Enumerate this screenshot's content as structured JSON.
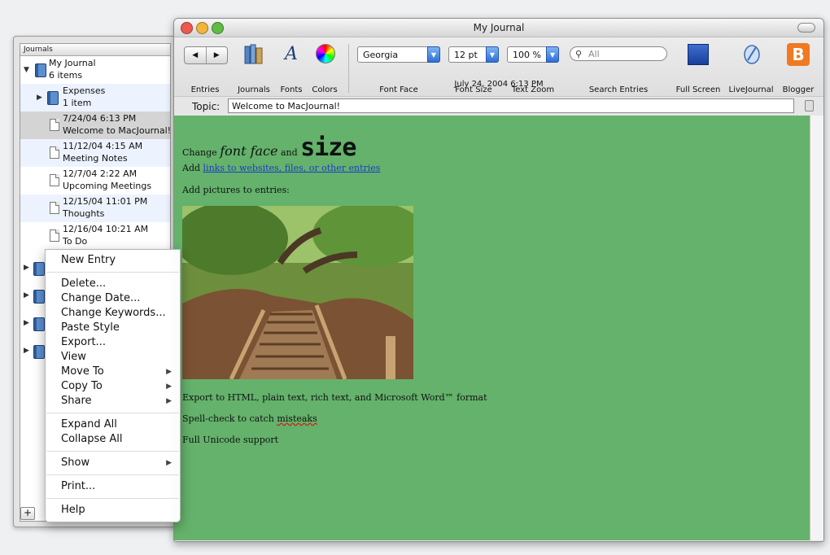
{
  "window": {
    "title": "My Journal",
    "date": "July 24, 2004 6:13 PM"
  },
  "toolbar": {
    "entries": "Entries",
    "journals": "Journals",
    "fonts": "Fonts",
    "colors": "Colors",
    "font_face_label": "Font Face",
    "font_face_value": "Georgia",
    "font_size_label": "Font Size",
    "font_size_value": "12 pt",
    "text_zoom_label": "Text Zoom",
    "text_zoom_value": "100 %",
    "search_label": "Search Entries",
    "search_placeholder": "All",
    "full_screen": "Full Screen",
    "livejournal": "LiveJournal",
    "blogger": "Blogger",
    "nav_prev": "◀",
    "nav_next": "▶"
  },
  "topic": {
    "label": "Topic:",
    "value": "Welcome to MacJournal!"
  },
  "drawer": {
    "header": "Journals",
    "items": [
      {
        "line1": "My Journal",
        "line2": "6 items"
      },
      {
        "line1": "Expenses",
        "line2": "1 item"
      },
      {
        "line1": "7/24/04 6:13 PM",
        "line2": "Welcome to MacJournal!"
      },
      {
        "line1": "11/12/04 4:15 AM",
        "line2": "Meeting Notes"
      },
      {
        "line1": "12/7/04 2:22 AM",
        "line2": "Upcoming Meetings"
      },
      {
        "line1": "12/15/04 11:01 PM",
        "line2": "Thoughts"
      },
      {
        "line1": "12/16/04 10:21 AM",
        "line2": "To Do"
      }
    ],
    "add_button": "+"
  },
  "content": {
    "line1_a": "Change",
    "line1_b": "font face",
    "line1_c": "and",
    "line1_d": "size",
    "line2_a": "Add",
    "line2_link": "links to websites, files, or other entries",
    "line3": "Add pictures to entries:",
    "line4": "Export to HTML, plain text, rich text, and Microsoft Word™ format",
    "line5_a": "Spell-check to catch",
    "line5_b": "misteaks",
    "line6": "Full Unicode support"
  },
  "menu": {
    "new_entry": "New Entry",
    "delete": "Delete...",
    "change_date": "Change Date...",
    "change_keywords": "Change Keywords...",
    "paste_style": "Paste Style",
    "export": "Export...",
    "view": "View",
    "move_to": "Move To",
    "copy_to": "Copy To",
    "share": "Share",
    "expand_all": "Expand All",
    "collapse_all": "Collapse All",
    "show": "Show",
    "print": "Print...",
    "help": "Help"
  },
  "colors": {
    "content_bg": "#64b26b",
    "link": "#1d3cc7",
    "blogger": "#f07a22",
    "selection": "#d4d4d4"
  }
}
